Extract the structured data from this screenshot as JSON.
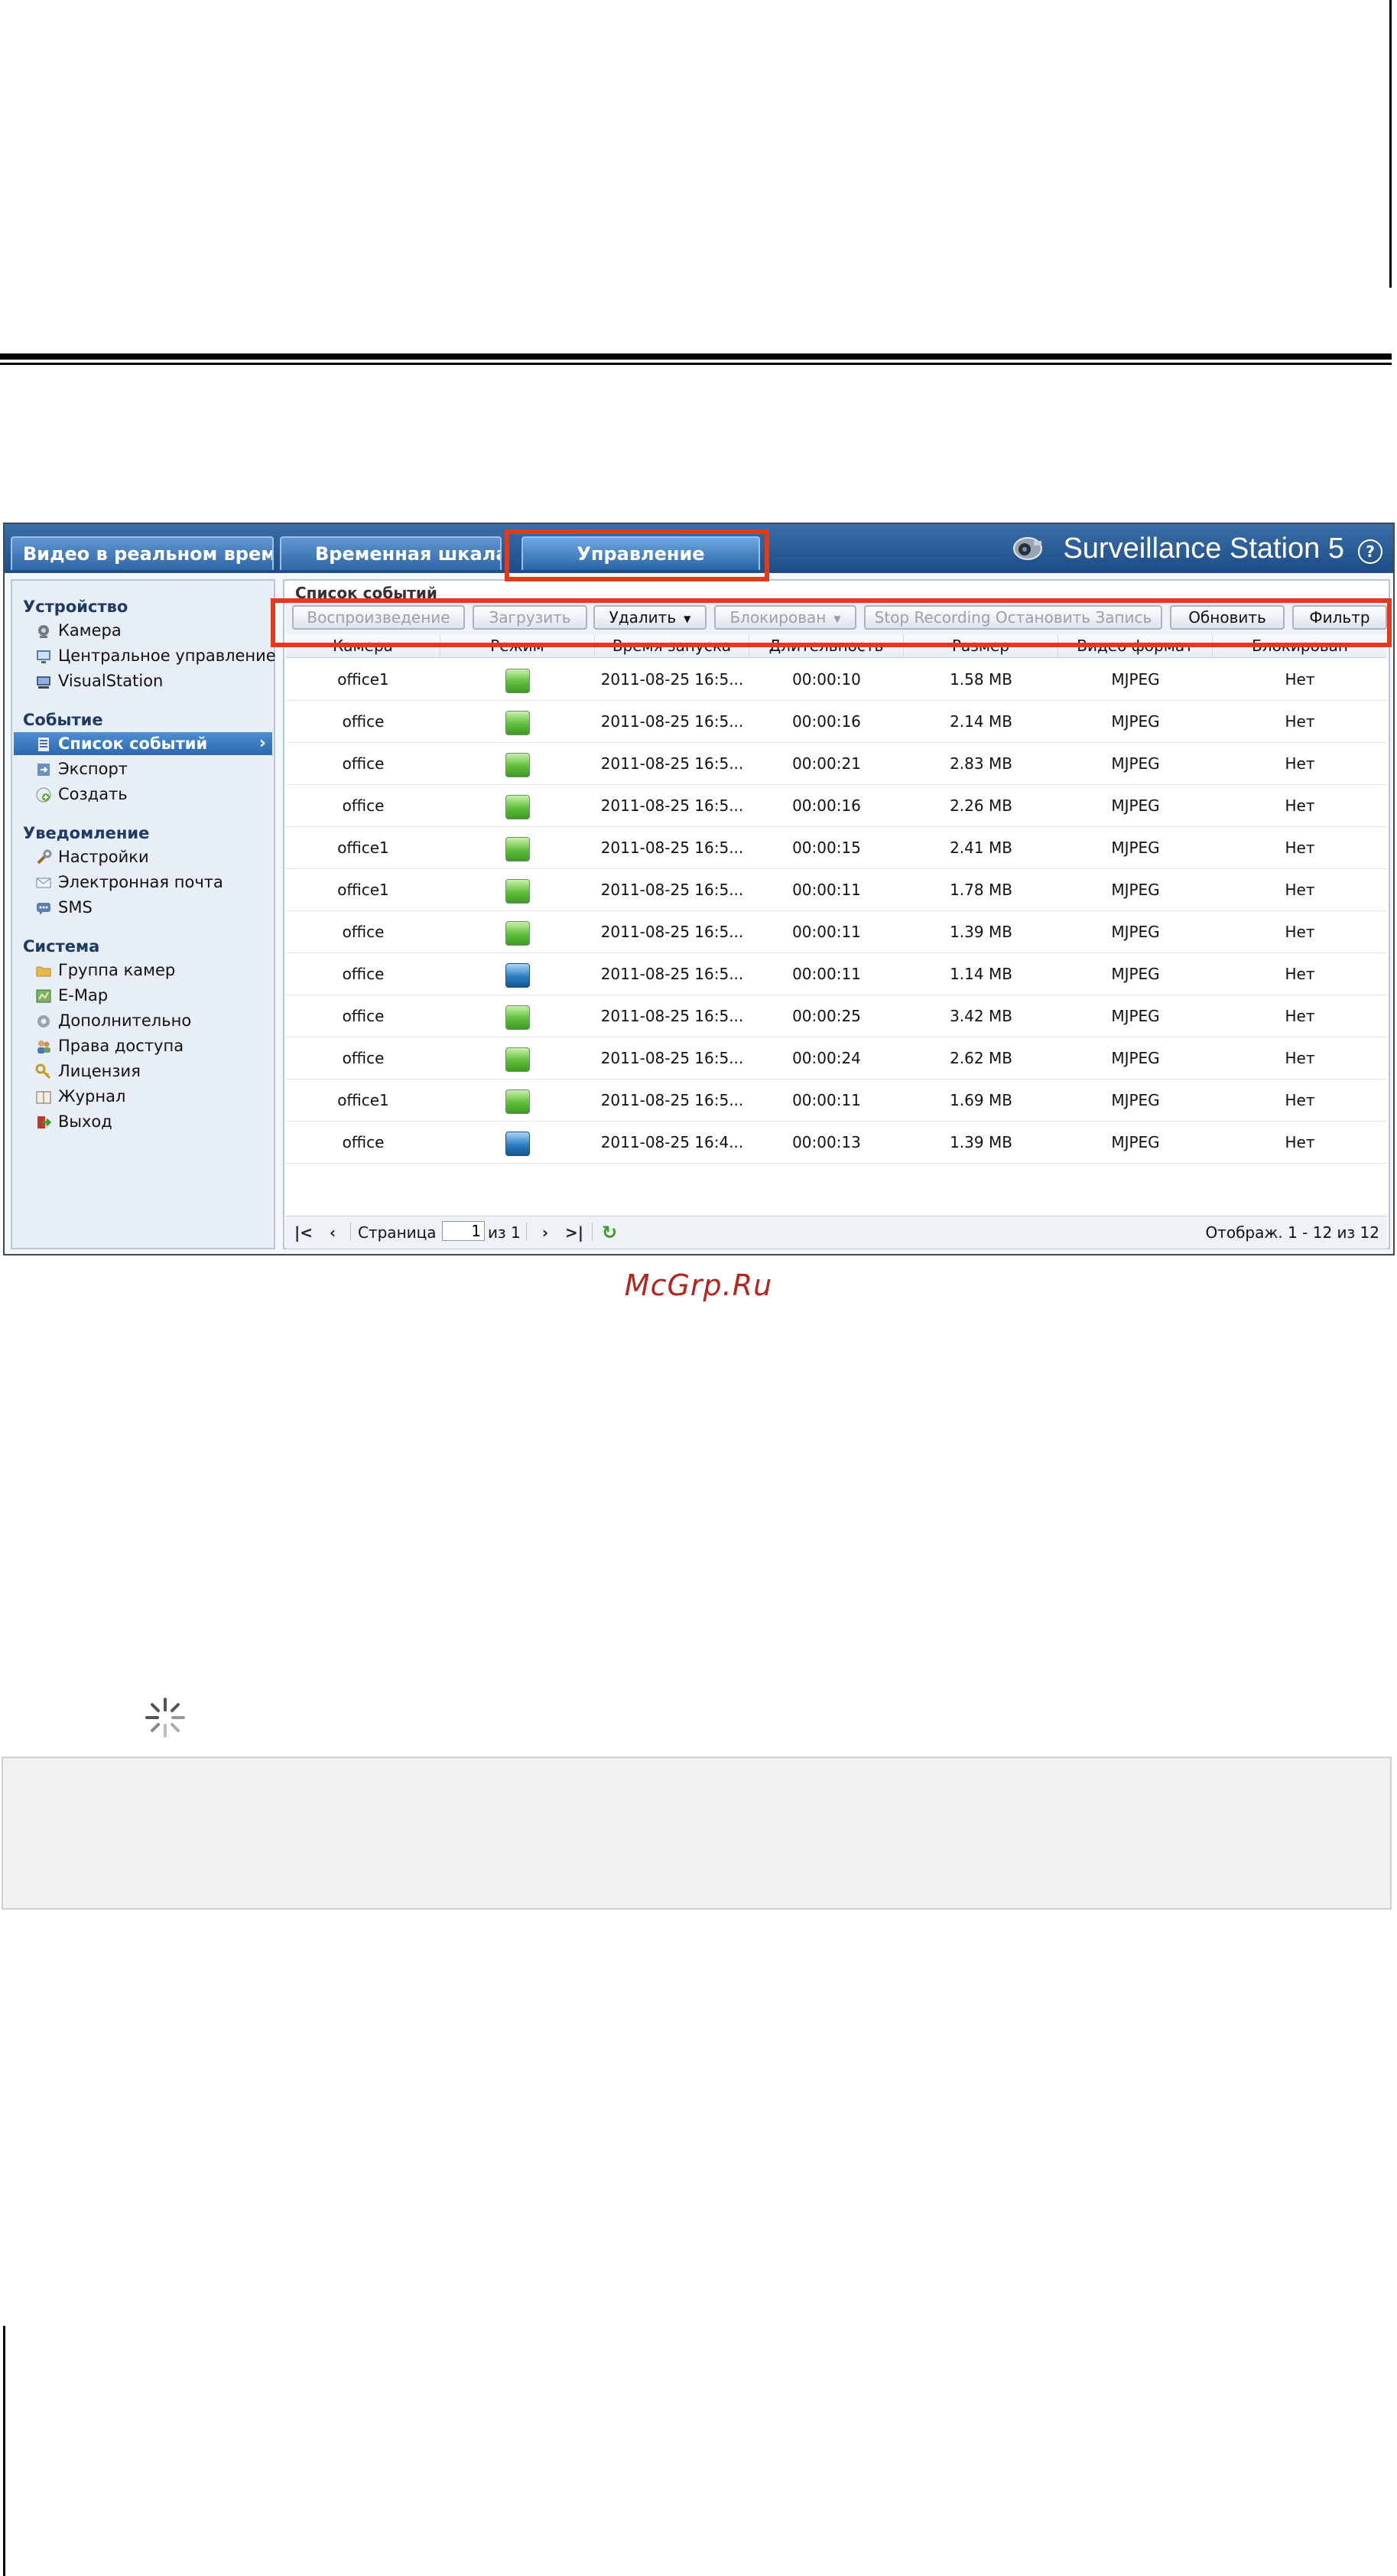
{
  "app": {
    "tabs": [
      {
        "label": "Видео в реальном времени"
      },
      {
        "label": "Временная шкала"
      },
      {
        "label": "Управление"
      }
    ],
    "brand": "Surveillance Station 5",
    "help": "?"
  },
  "sidebar": {
    "sections": [
      {
        "title": "Устройство",
        "items": [
          "Камера",
          "Центральное управление",
          "VisualStation"
        ]
      },
      {
        "title": "Событие",
        "items": [
          "Список событий",
          "Экспорт",
          "Создать"
        ]
      },
      {
        "title": "Уведомление",
        "items": [
          "Настройки",
          "Электронная почта",
          "SMS"
        ]
      },
      {
        "title": "Система",
        "items": [
          "Группа камер",
          "E-Map",
          "Дополнительно",
          "Права доступа",
          "Лицензия",
          "Журнал",
          "Выход"
        ]
      }
    ],
    "active_item": "Список событий"
  },
  "panel": {
    "title": "Список событий",
    "toolbar": {
      "play": "Воспроизведение",
      "download": "Загрузить",
      "delete": "Удалить",
      "lock": "Блокирован",
      "stop_recording": "Stop Recording Остановить Запись",
      "refresh": "Обновить",
      "filter": "Фильтр"
    },
    "columns": [
      "Камера",
      "Режим",
      "Время запуска",
      "Длительность",
      "Размер",
      "Видео формат",
      "Блокирован"
    ],
    "rows": [
      {
        "camera": "office1",
        "mode": "green",
        "start": "2011-08-25 16:5...",
        "duration": "00:00:10",
        "size": "1.58 MB",
        "format": "MJPEG",
        "locked": "Нет"
      },
      {
        "camera": "office",
        "mode": "green",
        "start": "2011-08-25 16:5...",
        "duration": "00:00:16",
        "size": "2.14 MB",
        "format": "MJPEG",
        "locked": "Нет"
      },
      {
        "camera": "office",
        "mode": "green",
        "start": "2011-08-25 16:5...",
        "duration": "00:00:21",
        "size": "2.83 MB",
        "format": "MJPEG",
        "locked": "Нет"
      },
      {
        "camera": "office",
        "mode": "green",
        "start": "2011-08-25 16:5...",
        "duration": "00:00:16",
        "size": "2.26 MB",
        "format": "MJPEG",
        "locked": "Нет"
      },
      {
        "camera": "office1",
        "mode": "green",
        "start": "2011-08-25 16:5...",
        "duration": "00:00:15",
        "size": "2.41 MB",
        "format": "MJPEG",
        "locked": "Нет"
      },
      {
        "camera": "office1",
        "mode": "green",
        "start": "2011-08-25 16:5...",
        "duration": "00:00:11",
        "size": "1.78 MB",
        "format": "MJPEG",
        "locked": "Нет"
      },
      {
        "camera": "office",
        "mode": "green",
        "start": "2011-08-25 16:5...",
        "duration": "00:00:11",
        "size": "1.39 MB",
        "format": "MJPEG",
        "locked": "Нет"
      },
      {
        "camera": "office",
        "mode": "blue",
        "start": "2011-08-25 16:5...",
        "duration": "00:00:11",
        "size": "1.14 MB",
        "format": "MJPEG",
        "locked": "Нет"
      },
      {
        "camera": "office",
        "mode": "green",
        "start": "2011-08-25 16:5...",
        "duration": "00:00:25",
        "size": "3.42 MB",
        "format": "MJPEG",
        "locked": "Нет"
      },
      {
        "camera": "office",
        "mode": "green",
        "start": "2011-08-25 16:5...",
        "duration": "00:00:24",
        "size": "2.62 MB",
        "format": "MJPEG",
        "locked": "Нет"
      },
      {
        "camera": "office1",
        "mode": "green",
        "start": "2011-08-25 16:5...",
        "duration": "00:00:11",
        "size": "1.69 MB",
        "format": "MJPEG",
        "locked": "Нет"
      },
      {
        "camera": "office",
        "mode": "blue",
        "start": "2011-08-25 16:4...",
        "duration": "00:00:13",
        "size": "1.39 MB",
        "format": "MJPEG",
        "locked": "Нет"
      }
    ],
    "pager": {
      "page_label": "Страница",
      "page_value": "1",
      "of_label": "из 1",
      "display": "Отображ. 1 - 12 из 12"
    }
  },
  "watermark": "McGrp.Ru",
  "colors": {
    "highlight": "#e23b1c",
    "header_blue": "#1d4c86",
    "mode_green": "#5fbe3a",
    "mode_blue": "#2b7fc4"
  }
}
